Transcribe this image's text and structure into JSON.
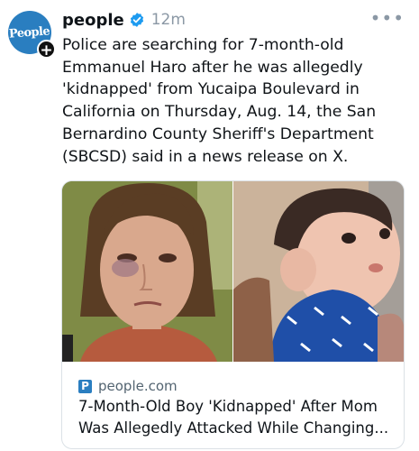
{
  "post": {
    "username": "people",
    "timestamp": "12m",
    "avatar_logo": "People",
    "text": "Police are searching for 7-month-old Emmanuel Haro after he was allegedly 'kidnapped' from Yucaipa Boulevard in California on Thursday, Aug. 14, the San Bernardino County Sheriff's Department (SBCSD) said in a news release on X."
  },
  "card": {
    "source_icon_letter": "P",
    "domain": "people.com",
    "title": "7-Month-Old Boy 'Kidnapped' After Mom Was Allegedly Attacked While Changing..."
  },
  "icons": {
    "avatar": "people-logo-icon",
    "follow": "plus-icon",
    "verified": "verified-check-icon",
    "more": "more-horizontal-icon",
    "source": "people-favicon-icon"
  },
  "colors": {
    "brand_blue": "#2a7ec0",
    "verified_blue": "#1d9bf0",
    "muted_text": "#8b98a5",
    "text": "#0f1419"
  }
}
